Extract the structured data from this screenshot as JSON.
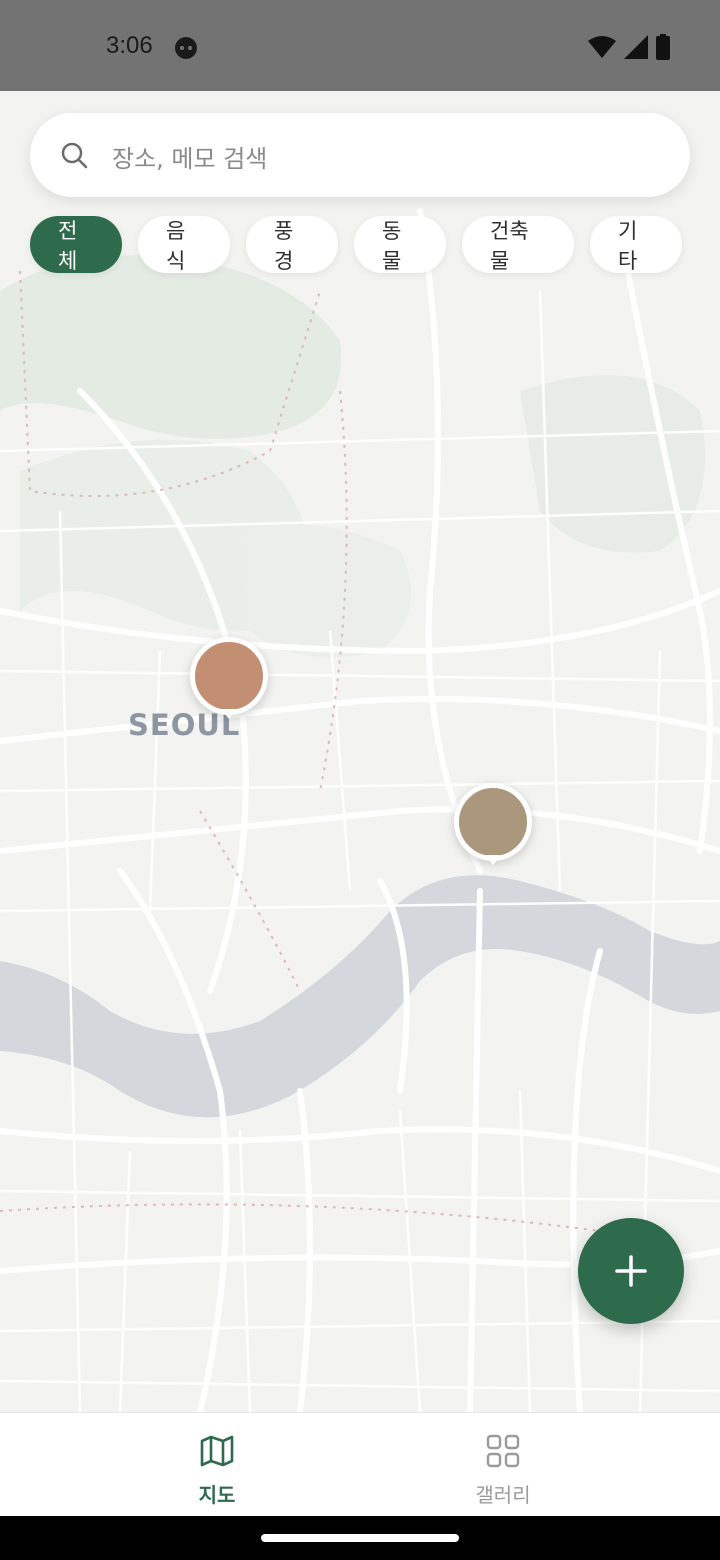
{
  "status_bar": {
    "time": "3:06",
    "icons": [
      "face-icon",
      "wifi-icon",
      "signal-icon",
      "battery-icon"
    ]
  },
  "search": {
    "placeholder": "장소, 메모 검색",
    "icon": "search-icon"
  },
  "filters": {
    "items": [
      {
        "label": "전체",
        "active": true
      },
      {
        "label": "음식",
        "active": false
      },
      {
        "label": "풍경",
        "active": false
      },
      {
        "label": "동물",
        "active": false
      },
      {
        "label": "건축물",
        "active": false
      },
      {
        "label": "기타",
        "active": false
      }
    ]
  },
  "map": {
    "city_label": "SEOUL",
    "pins": [
      {
        "name": "pin-1",
        "color": "#c28f72"
      },
      {
        "name": "pin-2",
        "color": "#ab977c"
      }
    ],
    "river_color": "#d4d8dc"
  },
  "fab": {
    "icon": "plus-icon",
    "color": "#2e6a4c"
  },
  "bottom_nav": {
    "items": [
      {
        "label": "지도",
        "icon": "map-icon",
        "active": true
      },
      {
        "label": "갤러리",
        "icon": "grid-icon",
        "active": false
      }
    ]
  },
  "colors": {
    "accent": "#2e6a4c",
    "map_bg": "#f3f4f2",
    "status_bar": "#737373"
  }
}
